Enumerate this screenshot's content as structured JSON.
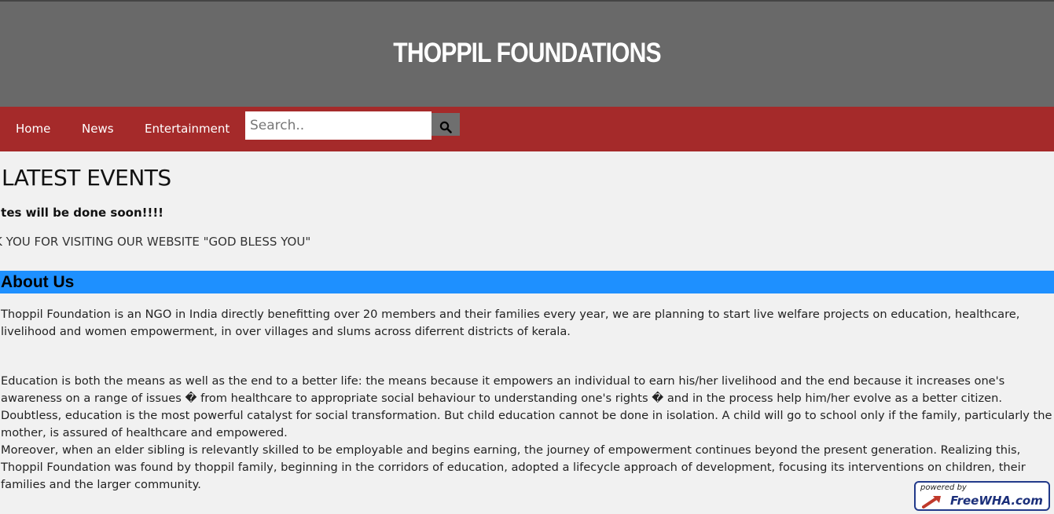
{
  "header": {
    "title": "THOPPIL FOUNDATIONS"
  },
  "nav": {
    "items": [
      {
        "label": "Home"
      },
      {
        "label": "News"
      },
      {
        "label": "Entertainment"
      }
    ],
    "search": {
      "placeholder": "Search..",
      "icon": "search-icon"
    }
  },
  "latest": {
    "title": "LATEST EVENTS",
    "ticker_bold": "ates will be done soon!!!!",
    "ticker_text": "K YOU FOR VISITING OUR WEBSITE \"GOD BLESS YOU\""
  },
  "about": {
    "heading": "About Us",
    "para1": "Thoppil Foundation is an NGO in India directly benefitting over 20 members and their families every year, we are planning to start live welfare projects on education, healthcare, livelihood and women empowerment, in over villages and slums across diferrent districts of kerala.",
    "para2": "Education is both the means as well as the end to a better life: the means because it empowers an individual to earn his/her livelihood and the end because it increases one's awareness on a range of issues � from healthcare to appropriate social behaviour to understanding one's rights � and in the process help him/her evolve as a better citizen. Doubtless, education is the most powerful catalyst for social transformation. But child education cannot be done in isolation. A child will go to school only if the family, particularly the mother, is assured of healthcare and empowered.",
    "para3": "Moreover, when an elder sibling is relevantly skilled to be employable and begins earning, the journey of empowerment continues beyond the present generation. Realizing this, Thoppil Foundation was found by thoppil family, beginning in the corridors of education, adopted a lifecycle approach of development, focusing its interventions on children, their families and the larger community."
  },
  "badge": {
    "small": "powered by",
    "brand": "FreeWHA.com"
  },
  "colors": {
    "header": "#696969",
    "nav": "#a52a2a",
    "about_bar": "#1e90ff",
    "background": "#f1f1f1"
  }
}
